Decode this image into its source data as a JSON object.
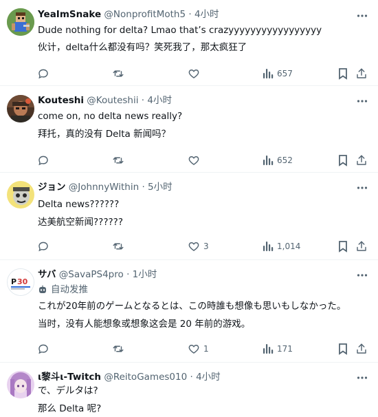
{
  "colors": {
    "text": "#0f1419",
    "secondary": "#536471",
    "divider": "#eff3f4",
    "icon": "#536471"
  },
  "replies": [
    {
      "name": "YeaImSnake",
      "handle": "@NonprofitMoth5",
      "dot": "·",
      "time": "4小时",
      "lines": [
        "Dude nothing for delta? Lmao that’s crazyyyyyyyyyyyyyyyyy",
        "伙计，delta什么都没有吗？笑死我了，那太疯狂了"
      ],
      "likes": "",
      "views": "657"
    },
    {
      "name": "Kouteshi",
      "handle": "@Kouteshii",
      "dot": "·",
      "time": "4小时",
      "lines": [
        "come on, no delta news really?",
        "拜托，真的没有 Delta 新闻吗？"
      ],
      "likes": "",
      "views": "652"
    },
    {
      "name": "ジョン",
      "handle": "@JohnnyWithin",
      "dot": "·",
      "time": "5小时",
      "lines": [
        "Delta news??????",
        "达美航空新闻??????"
      ],
      "likes": "3",
      "views": "1,014"
    },
    {
      "name": "サバ",
      "handle": "@SavaPS4pro",
      "dot": "·",
      "time": "1小时",
      "automated": "自动发推",
      "lines": [
        "これが20年前のゲームとなるとは、この時誰も想像も思いもしなかった。",
        "当时，没有人能想象或想象这会是 20 年前的游戏。"
      ],
      "likes": "1",
      "views": "171"
    },
    {
      "name": "ι黎斗ι-Twitch",
      "handle": "@ReitoGames010",
      "dot": "·",
      "time": "4小时",
      "lines": [
        "で、デルタは?",
        "那么 Delta 呢?"
      ],
      "likes": "",
      "views": ""
    }
  ],
  "icons": {
    "avatar_0": "pixel-character-avatar-icon",
    "avatar_1": "soldier-avatar-icon",
    "avatar_2": "cartoon-face-avatar-icon",
    "avatar_3": "ps-30th-anniversary-avatar-icon",
    "avatar_4": "anime-girl-avatar-icon",
    "automated": "robot-icon"
  }
}
